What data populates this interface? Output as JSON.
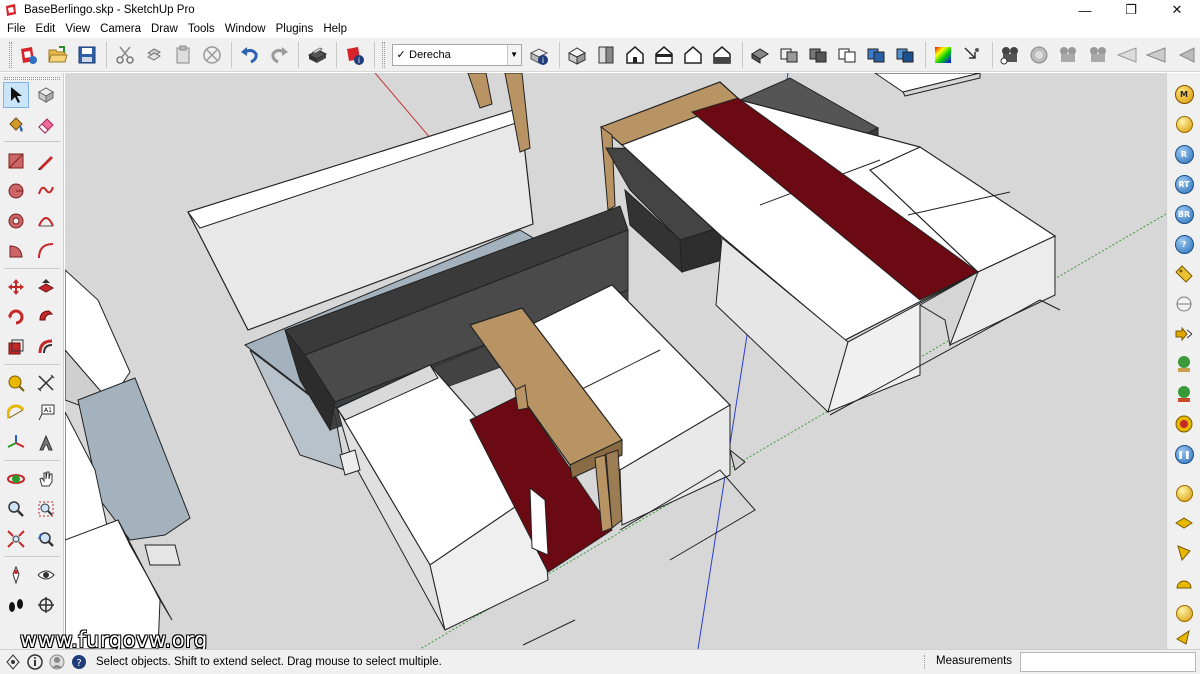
{
  "window": {
    "title": "BaseBerlingo.skp - SketchUp Pro",
    "minimize_glyph": "—",
    "restore_glyph": "❐",
    "close_glyph": "✕"
  },
  "menu": [
    "File",
    "Edit",
    "View",
    "Camera",
    "Draw",
    "Tools",
    "Window",
    "Plugins",
    "Help"
  ],
  "toolbar": {
    "scene_select": {
      "check": "✓",
      "value": "Derecha",
      "arrow": "▼"
    }
  },
  "left_tools": [
    "select-tool",
    "make-component-tool",
    "paint-bucket-tool",
    "eraser-tool",
    "rectangle-tool",
    "line-tool",
    "circle-tool",
    "freehand-tool",
    "polygon-tool",
    "arc-tool",
    "pie-tool",
    "two-point-arc-tool",
    "move-tool",
    "push-pull-tool",
    "rotate-tool",
    "follow-me-tool",
    "scale-tool",
    "offset-tool",
    "tape-measure-tool",
    "text-tool",
    "protractor-tool",
    "3d-text-tool",
    "axes-tool",
    "dimension-tool",
    "orbit-tool",
    "pan-tool",
    "zoom-tool",
    "zoom-window-tool",
    "zoom-extents-tool",
    "previous-view-tool",
    "position-camera-tool",
    "look-around-tool",
    "walk-tool",
    "section-plane-tool"
  ],
  "right_tools": {
    "m_label": "M",
    "r_label": "R",
    "rt_label": "RT",
    "br_label": "BR",
    "help_label": "?"
  },
  "watermark": "www.furgovw.org",
  "status": {
    "message": "Select objects. Shift to extend select. Drag mouse to select multiple.",
    "measurements_label": "Measurements",
    "measurements_value": ""
  },
  "colors": {
    "viewport_bg": "#d7d7d7",
    "box_white": "#ffffff",
    "box_dark": "#505050",
    "carpet_red": "#6b0a12",
    "wood": "#b89464",
    "glass_blue": "#a4b2bd"
  }
}
